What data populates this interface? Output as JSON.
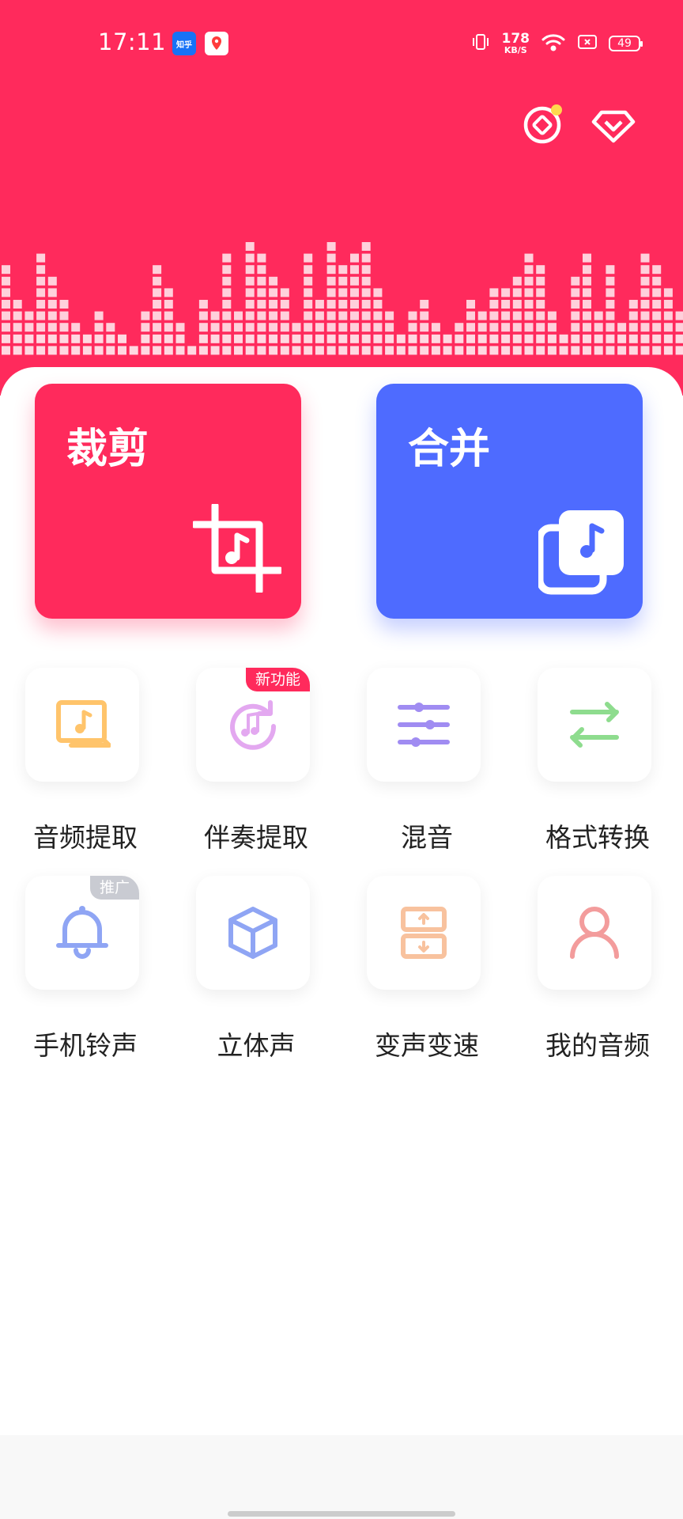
{
  "status_bar": {
    "time": "17:11",
    "notif_zhihu": "知乎",
    "net_speed_value": "178",
    "net_speed_unit": "KB/S",
    "battery": "49"
  },
  "header": {
    "coin_button": "coin-icon",
    "vip_button": "diamond-icon"
  },
  "big_cards": {
    "cut_label": "裁剪",
    "merge_label": "合并"
  },
  "tools": [
    {
      "name": "音频提取",
      "icon": "audio-extract-icon",
      "badge": "",
      "color": "#FFC46B"
    },
    {
      "name": "伴奏提取",
      "icon": "accompaniment-icon",
      "badge": "新功能",
      "color": "#E3A8F0"
    },
    {
      "name": "混音",
      "icon": "mixer-icon",
      "badge": "",
      "color": "#A08CF2"
    },
    {
      "name": "格式转换",
      "icon": "convert-icon",
      "badge": "",
      "color": "#8EDC8E"
    },
    {
      "name": "手机铃声",
      "icon": "bell-icon",
      "badge": "推广",
      "color": "#8FA5F4"
    },
    {
      "name": "立体声",
      "icon": "stereo-cube-icon",
      "badge": "",
      "color": "#8FA5F4"
    },
    {
      "name": "变声变速",
      "icon": "voice-speed-icon",
      "badge": "",
      "color": "#F8C29E"
    },
    {
      "name": "我的音频",
      "icon": "user-icon",
      "badge": "",
      "color": "#F39C9C"
    }
  ],
  "colors": {
    "primary": "#FF2A5C",
    "merge": "#4E6BFF"
  }
}
